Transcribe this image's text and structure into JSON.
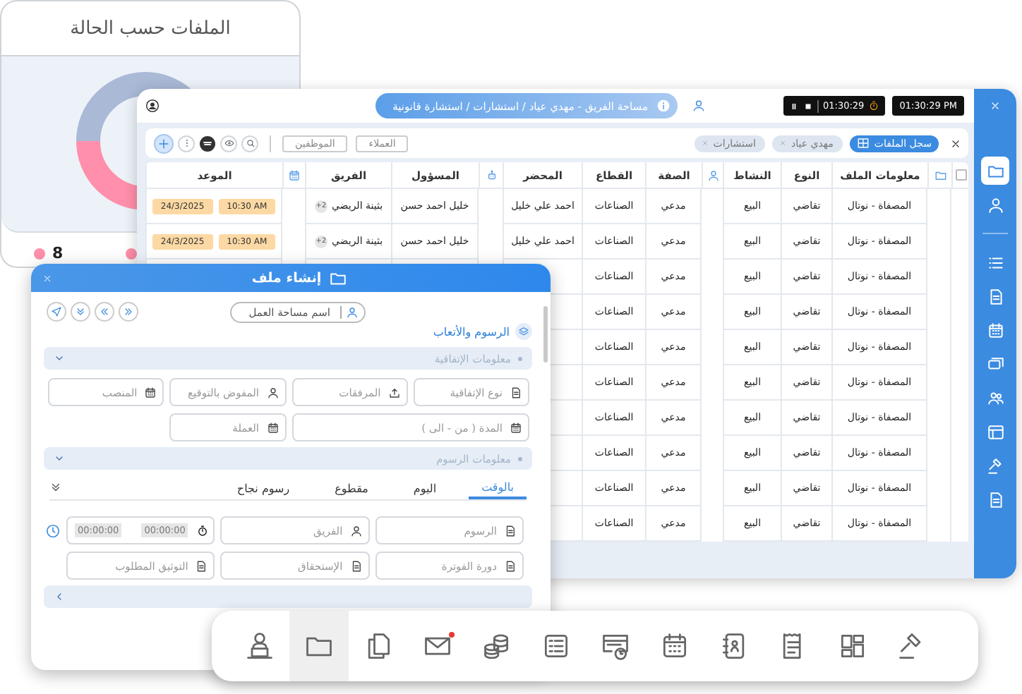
{
  "status_card": {
    "title": "الملفات حسب الحالة",
    "legend_value": "8"
  },
  "main_window": {
    "breadcrumb": "مساحة الفريق - مهدي عياد / استشارات / استشارة قانونية",
    "timer": "01:30:29",
    "clock": "01:30:29 PM",
    "toolbar": {
      "buttons": [
        "العملاء",
        "الموظفين"
      ],
      "chips": [
        {
          "label": "سجل الملفات",
          "kind": "active"
        },
        {
          "label": "مهدي عياد",
          "kind": "removable"
        },
        {
          "label": "استشارات",
          "kind": "removable"
        }
      ]
    },
    "table": {
      "header_checked": false,
      "columns": [
        "معلومات الملف",
        "النوع",
        "النشاط",
        "الصفة",
        "القطاع",
        "المحضر",
        "المسؤول",
        "الفريق",
        "الموعد"
      ],
      "rows": [
        {
          "file": "المصفاة - نوتال",
          "type": "تقاضي",
          "activity": "البيع",
          "role": "مدعي",
          "sector": "الصناعات",
          "bailiff": "احمد علي خليل",
          "owner": "خليل احمد حسن",
          "team": "بثينة الريضي",
          "team_extra": "+2",
          "time": "10:30 AM",
          "date": "24/3/2025"
        },
        {
          "file": "المصفاة - نوتال",
          "type": "تقاضي",
          "activity": "البيع",
          "role": "مدعي",
          "sector": "الصناعات",
          "bailiff": "احمد علي خليل",
          "owner": "خليل احمد حسن",
          "team": "بثينة الريضي",
          "team_extra": "+2",
          "time": "10:30 AM",
          "date": "24/3/2025"
        },
        {
          "file": "المصفاة - نوتال",
          "type": "تقاضي",
          "activity": "البيع",
          "role": "مدعي",
          "sector": "الصناعات"
        },
        {
          "file": "المصفاة - نوتال",
          "type": "تقاضي",
          "activity": "البيع",
          "role": "مدعي",
          "sector": "الصناعات"
        },
        {
          "file": "المصفاة - نوتال",
          "type": "تقاضي",
          "activity": "البيع",
          "role": "مدعي",
          "sector": "الصناعات"
        },
        {
          "file": "المصفاة - نوتال",
          "type": "تقاضي",
          "activity": "البيع",
          "role": "مدعي",
          "sector": "الصناعات"
        },
        {
          "file": "المصفاة - نوتال",
          "type": "تقاضي",
          "activity": "البيع",
          "role": "مدعي",
          "sector": "الصناعات"
        },
        {
          "file": "المصفاة - نوتال",
          "type": "تقاضي",
          "activity": "البيع",
          "role": "مدعي",
          "sector": "الصناعات"
        },
        {
          "file": "المصفاة - نوتال",
          "type": "تقاضي",
          "activity": "البيع",
          "role": "مدعي",
          "sector": "الصناعات"
        },
        {
          "file": "المصفاة - نوتال",
          "type": "تقاضي",
          "activity": "البيع",
          "role": "مدعي",
          "sector": "الصناعات"
        }
      ]
    },
    "sidebar": {
      "items": [
        {
          "selected": true
        },
        {
          "selected": false
        },
        {
          "selected": false
        },
        {
          "selected": false
        },
        {
          "selected": false
        },
        {
          "selected": false
        },
        {
          "selected": false
        },
        {
          "selected": false
        },
        {
          "selected": false
        },
        {
          "selected": false
        }
      ]
    }
  },
  "dialog": {
    "title": "إنشاء ملف",
    "workspace_placeholder": "اسم مساحة العمل",
    "section_title": "الرسوم والأتعاب",
    "groups": [
      {
        "title": "معلومات الإتفاقية",
        "expanded": true,
        "fields": [
          {
            "placeholder": "نوع الإتفاقية",
            "kind": "document"
          },
          {
            "placeholder": "المرفقات",
            "kind": "upload"
          },
          {
            "placeholder": "المفوض بالتوقيع",
            "kind": "person"
          },
          {
            "placeholder": "المنصب",
            "kind": "calendar"
          },
          {
            "placeholder": "المدة ( من - الى )",
            "kind": "date_range"
          },
          {
            "placeholder": "العملة",
            "kind": "calendar"
          }
        ]
      },
      {
        "title": "معلومات الرسوم",
        "expanded": true,
        "tabs": [
          {
            "label": "بالوقت",
            "selected": true
          },
          {
            "label": "اليوم",
            "selected": false
          },
          {
            "label": "مقطوع",
            "selected": false
          },
          {
            "label": "رسوم نجاح",
            "selected": false
          }
        ],
        "fields": [
          {
            "placeholder": "الرسوم",
            "kind": "document"
          },
          {
            "placeholder": "الفريق",
            "kind": "person"
          },
          {
            "kind": "time_range",
            "from": "00:00:00",
            "to": "00:00:00"
          },
          {
            "placeholder": "دورة الفوترة",
            "kind": "document"
          },
          {
            "placeholder": "الإستحقاق",
            "kind": "document"
          },
          {
            "placeholder": "التوثيق المطلوب",
            "kind": "document"
          }
        ]
      },
      {
        "expanded": false
      }
    ]
  },
  "dock": {
    "items": [
      {
        "selected": false
      },
      {
        "selected": true
      },
      {
        "selected": false
      },
      {
        "selected": false,
        "notification": true
      },
      {
        "selected": false
      },
      {
        "selected": false
      },
      {
        "selected": false
      },
      {
        "selected": false
      },
      {
        "selected": false
      },
      {
        "selected": false
      },
      {
        "selected": false
      },
      {
        "selected": false
      }
    ]
  }
}
